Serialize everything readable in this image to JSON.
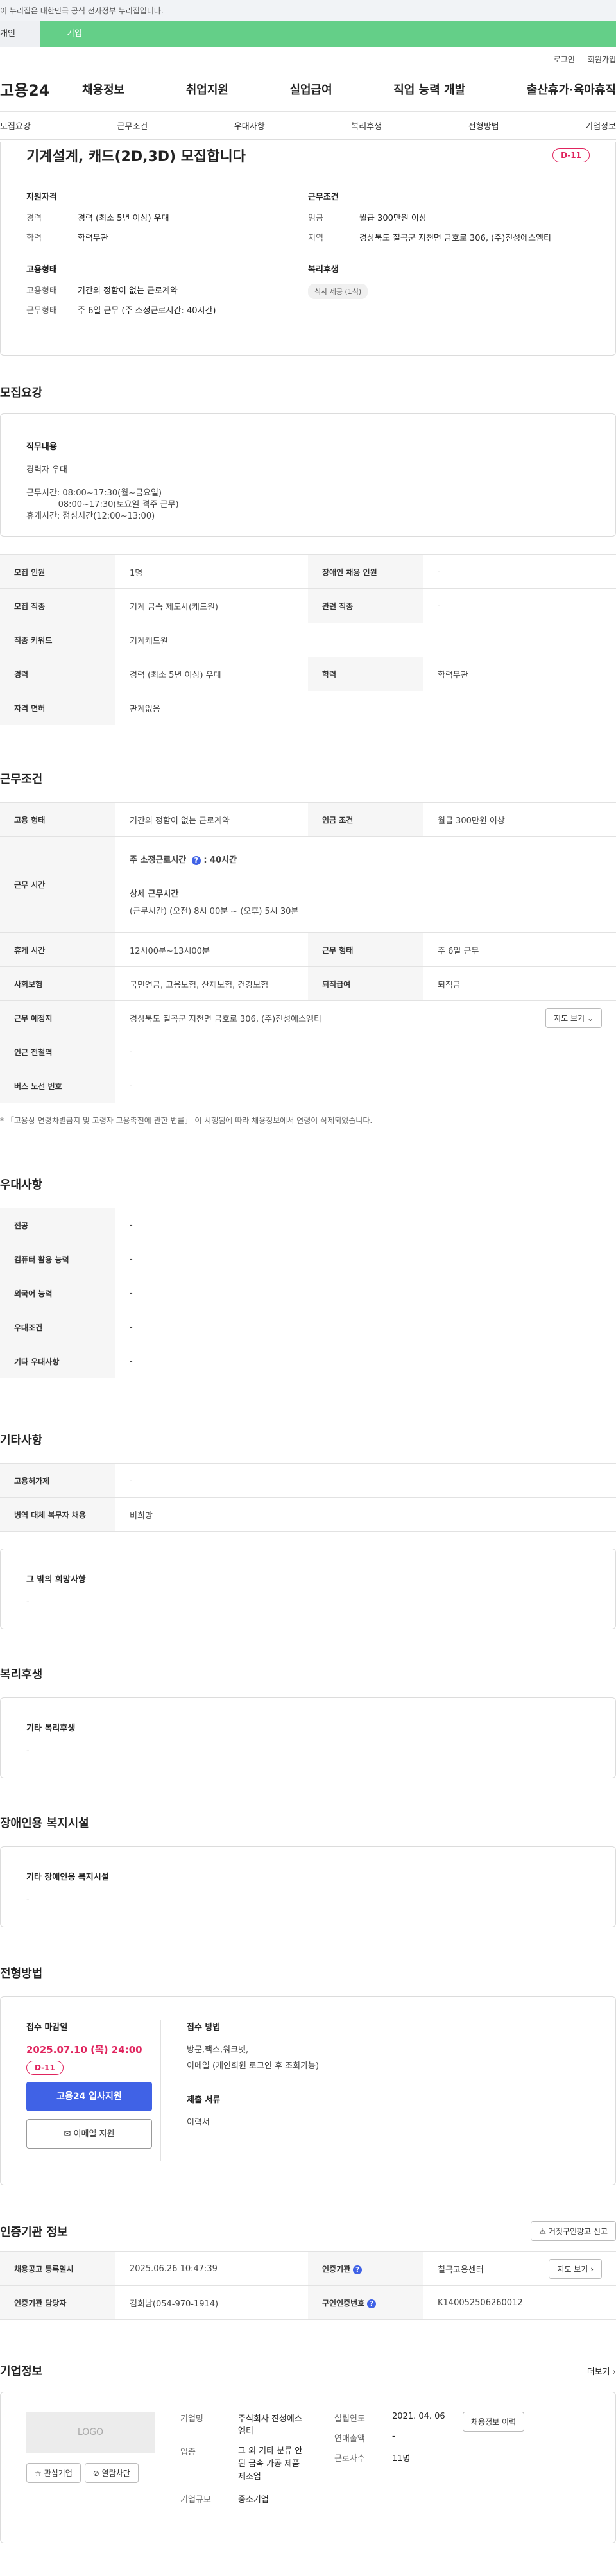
{
  "gov_bar": "이 누리집은 대한민국 공식 전자정부 누리집입니다.",
  "tabs": {
    "left": "개인",
    "right": "기업"
  },
  "util": {
    "login": "로그인",
    "signup": "회원가입"
  },
  "logo": "고용24",
  "gnb": [
    "채용정보",
    "취업지원",
    "실업급여",
    "직업 능력 개발",
    "출산휴가·육아휴직"
  ],
  "subnav": [
    "모집요강",
    "근무조건",
    "우대사항",
    "복리후생",
    "전형방법",
    "기업정보"
  ],
  "summary": {
    "title": "기계설계, 캐드(2D,3D) 모집합니다",
    "dday": "D-11",
    "qual_title": "지원자격",
    "qual": [
      {
        "k": "경력",
        "v": "경력 (최소 5년 이상) 우대"
      },
      {
        "k": "학력",
        "v": "학력무관"
      }
    ],
    "cond_title": "근무조건",
    "cond": [
      {
        "k": "임금",
        "v": "월급 300만원 이상"
      },
      {
        "k": "지역",
        "v": "경상북도 칠곡군 지천면 금호로 306, (주)진성에스엠티"
      }
    ],
    "emp_title": "고용형태",
    "emp": [
      {
        "k": "고용형태",
        "v": "기간의 정함이 없는 근로계약"
      },
      {
        "k": "근무형태",
        "v": "주 6일 근무 (주 소정근로시간: 40시간)"
      }
    ],
    "welfare_title": "복리후생",
    "welfare_chip": "식사 제공 (1식)"
  },
  "recruit": {
    "title": "모집요강",
    "duty_title": "직무내용",
    "duty_lines": [
      "경력자 우대",
      "",
      "근무시간: 08:00~17:30(월~금요일)",
      "            08:00~17:30(토요일 격주 근무)",
      "휴게시간: 점심시간(12:00~13:00)"
    ],
    "table": [
      [
        "모집 인원",
        "1명",
        "장애인 채용 인원",
        "-"
      ],
      [
        "모집 직종",
        "기계 금속 제도사(캐드원)",
        "관련 직종",
        "-"
      ],
      [
        "직종 키워드",
        "기계캐드원",
        "",
        ""
      ],
      [
        "경력",
        "경력 (최소 5년 이상) 우대",
        "학력",
        "학력무관"
      ],
      [
        "자격 면허",
        "관계없음",
        "",
        ""
      ]
    ]
  },
  "work": {
    "title": "근무조건",
    "emp_type_k": "고용 형태",
    "emp_type_v": "기간의 정함이 없는 근로계약",
    "wage_k": "임금 조건",
    "wage_v": "월급 300만원 이상",
    "hours_k": "근무 시간",
    "hours_total": "주 소정근로시간",
    "hours_total_v": ": 40시간",
    "hours_detail_title": "상세 근무시간",
    "hours_detail": "(근무시간) (오전) 8시 00분 ~ (오후) 5시 30분",
    "rows": [
      [
        "휴게 시간",
        "12시00분~13시00분",
        "근무 형태",
        "주 6일 근무"
      ],
      [
        "사회보험",
        "국민연금, 고용보험, 산재보험, 건강보험",
        "퇴직급여",
        "퇴직금"
      ]
    ],
    "place_k": "근무 예정지",
    "place_v": "경상북도 칠곡군 지천면 금호로 306, (주)진성에스엠티",
    "map_btn": "지도 보기",
    "subway_k": "인근 전철역",
    "subway_v": "-",
    "bus_k": "버스 노선 번호",
    "bus_v": "-",
    "note": "* 「고용상 연령차별금지 및 고령자 고용촉진에 관한 법률」 이 시행됨에 따라 채용정보에서 연령이 삭제되었습니다."
  },
  "pref": {
    "title": "우대사항",
    "rows": [
      [
        "전공",
        "-"
      ],
      [
        "컴퓨터 활용 능력",
        "-"
      ],
      [
        "외국어 능력",
        "-"
      ],
      [
        "우대조건",
        "-"
      ],
      [
        "기타 우대사항",
        "-"
      ]
    ]
  },
  "etc": {
    "title": "기타사항",
    "rows": [
      [
        "고용허가제",
        "-"
      ],
      [
        "병역 대체 복무자 채용",
        "비희망"
      ]
    ],
    "other_title": "그 밖의 희망사항",
    "other_v": "-"
  },
  "welfare": {
    "title": "복리후생",
    "box_title": "기타 복리후생",
    "box_v": "-"
  },
  "disabled": {
    "title": "장애인용 복지시설",
    "box_title": "기타 장애인용 복지시설",
    "box_v": "-"
  },
  "process": {
    "title": "전형방법",
    "deadline_label": "접수 마감일",
    "deadline": "2025.07.10 (목) 24:00",
    "dday": "D-11",
    "apply_btn": "고용24 입사지원",
    "email_btn": "이메일 지원",
    "method_title": "접수 방법",
    "method_v1": "방문,팩스,워크넷,",
    "method_v2": "이메일 (개인회원 로그인 후 조회가능)",
    "docs_title": "제출 서류",
    "docs_v": "이력서"
  },
  "cert": {
    "title": "인증기관 정보",
    "report_btn": "거짓구인광고 신고",
    "reg_k": "채용공고 등록일시",
    "reg_v": "2025.06.26 10:47:39",
    "org_k": "인증기관",
    "org_v": "칠곡고용센터",
    "map_btn": "지도 보기",
    "mgr_k": "인증기관 담당자",
    "mgr_v": "김희남(054-970-1914)",
    "no_k": "구인인증번호",
    "no_v": "K140052506260012"
  },
  "company": {
    "title": "기업정보",
    "more": "더보기",
    "logo_text": "LOGO",
    "fav_btn": "관심기업",
    "block_btn": "열람차단",
    "name_k": "기업명",
    "name_v": "주식회사 진성에스엠티",
    "biz_k": "업종",
    "biz_v": "그 외 기타 분류 안된 금속 가공 제품 제조업",
    "scale_k": "기업규모",
    "scale_v": "중소기업",
    "est_k": "설립연도",
    "est_v": "2021. 04. 06",
    "sales_k": "연매출액",
    "sales_v": "-",
    "emp_k": "근로자수",
    "emp_v": "11명",
    "history_btn": "채용정보 이력"
  }
}
